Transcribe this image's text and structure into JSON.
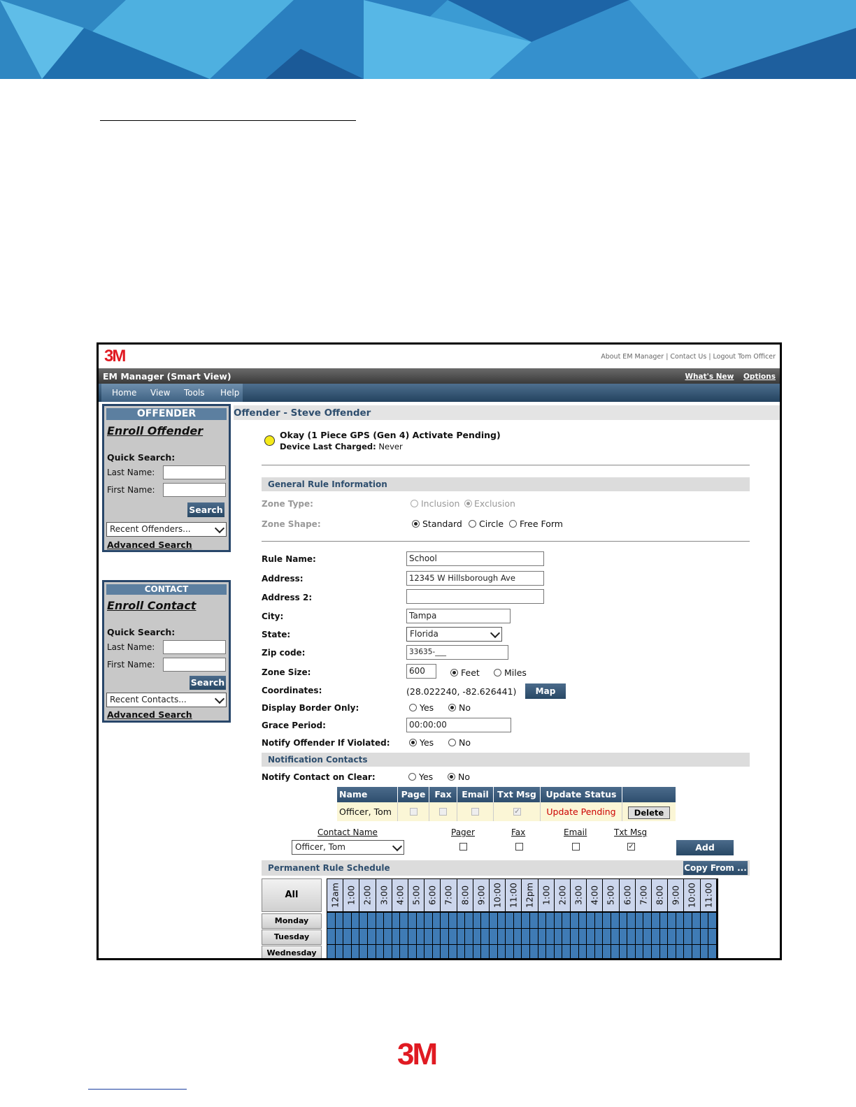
{
  "app": {
    "brand": "3M",
    "top_links": "About EM Manager | Contact Us | Logout Tom Officer",
    "title": "EM Manager (Smart View)",
    "title_links": [
      "What's New",
      "Options"
    ],
    "menu": [
      "Home",
      "View",
      "Tools",
      "Help"
    ]
  },
  "offender_panel": {
    "header": "OFFENDER",
    "enroll": "Enroll Offender",
    "quick_search": "Quick Search:",
    "last_name": "Last Name:",
    "first_name": "First Name:",
    "search": "Search",
    "recent": "Recent Offenders...",
    "advanced": "Advanced Search"
  },
  "contact_panel": {
    "header": "CONTACT",
    "enroll": "Enroll Contact",
    "quick_search": "Quick Search:",
    "last_name": "Last Name:",
    "first_name": "First Name:",
    "search": "Search",
    "recent": "Recent Contacts...",
    "advanced": "Advanced Search"
  },
  "main": {
    "title": "Offender - Steve Offender",
    "status_line": "Okay (1 Piece GPS (Gen 4) Activate Pending)",
    "device_label": "Device Last Charged:",
    "device_value": "Never",
    "general_section": "General Rule Information",
    "zone_type_label": "Zone Type:",
    "zone_type_options": [
      "Inclusion",
      "Exclusion"
    ],
    "zone_shape_label": "Zone Shape:",
    "zone_shape_options": [
      "Standard",
      "Circle",
      "Free Form"
    ],
    "rule_name_label": "Rule Name:",
    "rule_name": "School",
    "address_label": "Address:",
    "address": "12345 W Hillsborough Ave",
    "address2_label": "Address 2:",
    "address2": "",
    "city_label": "City:",
    "city": "Tampa",
    "state_label": "State:",
    "state": "Florida",
    "zip_label": "Zip code:",
    "zip": "33635-___",
    "zone_size_label": "Zone Size:",
    "zone_size": "600",
    "zone_size_units": [
      "Feet",
      "Miles"
    ],
    "coordinates_label": "Coordinates:",
    "coordinates": "(28.022240, -82.626441)",
    "map_button": "Map",
    "border_label": "Display Border Only:",
    "grace_label": "Grace Period:",
    "grace": "00:00:00",
    "notify_label": "Notify Offender If Violated:",
    "yes": "Yes",
    "no": "No",
    "notification_section": "Notification Contacts",
    "notify_clear_label": "Notify Contact on Clear:",
    "contacts_table": {
      "headers": [
        "Name",
        "Page",
        "Fax",
        "Email",
        "Txt Msg",
        "Update Status"
      ],
      "row": {
        "name": "Officer, Tom",
        "status": "Update Pending"
      },
      "delete": "Delete"
    },
    "add_contact": {
      "headers": [
        "Contact Name",
        "Pager",
        "Fax",
        "Email",
        "Txt Msg"
      ],
      "selected": "Officer, Tom",
      "add": "Add"
    },
    "schedule_section": "Permanent Rule Schedule",
    "copy_from": "Copy From ...",
    "all": "All",
    "days": [
      "Monday",
      "Tuesday",
      "Wednesday"
    ],
    "hours": [
      "12am",
      "1:00",
      "2:00",
      "3:00",
      "4:00",
      "5:00",
      "6:00",
      "7:00",
      "8:00",
      "9:00",
      "10:00",
      "11:00",
      "12pm",
      "1:00",
      "2:00",
      "3:00",
      "4:00",
      "5:00",
      "6:00",
      "7:00",
      "8:00",
      "9:00",
      "10:00",
      "11:00"
    ]
  },
  "colors": {
    "brand_red": "#e01a22",
    "header_blue": "#2e4e6e",
    "schedule_blue": "#3f7bb5",
    "status_red": "#cc0000"
  },
  "footer": {
    "brand": "3M"
  }
}
